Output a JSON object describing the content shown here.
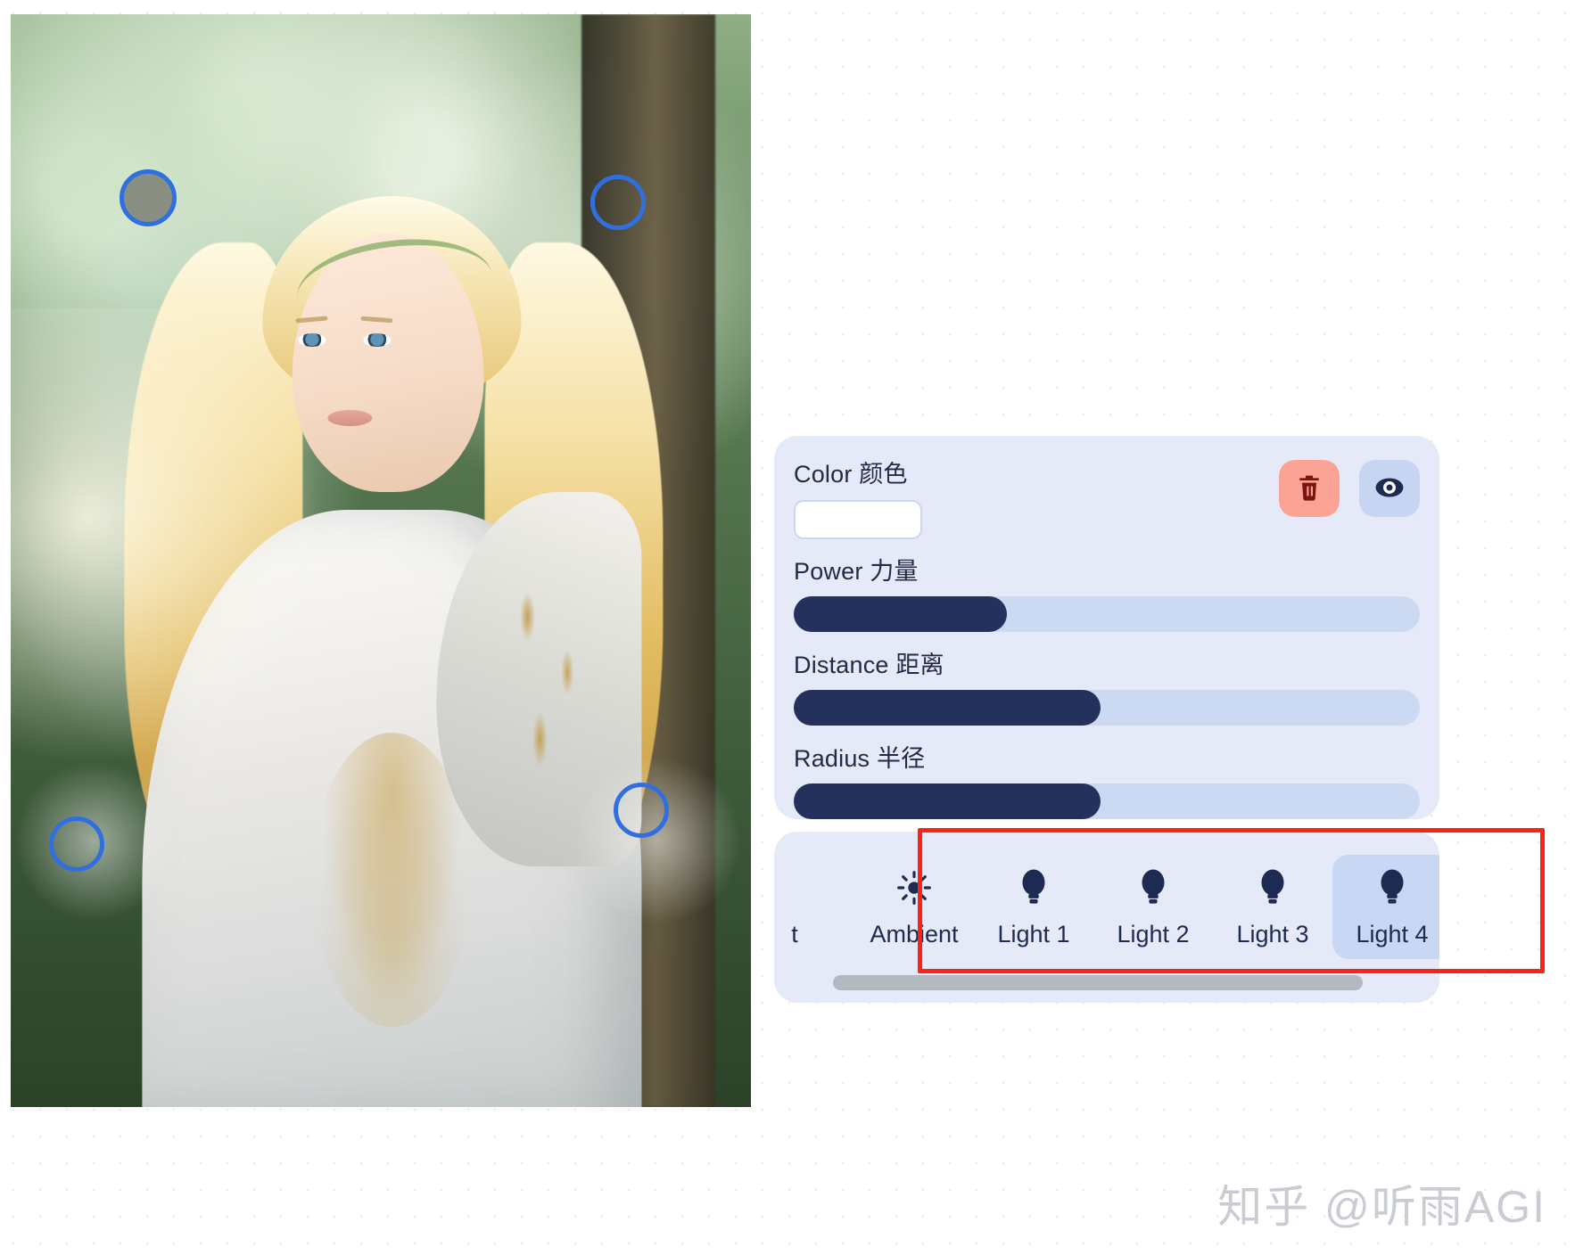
{
  "app": {
    "watermark": "知乎 @听雨AGI"
  },
  "canvas": {
    "name": "light-editor-canvas",
    "handles": [
      {
        "id": "handle-1",
        "style": "filled"
      },
      {
        "id": "handle-2",
        "style": "outline"
      },
      {
        "id": "handle-3",
        "style": "outline"
      },
      {
        "id": "handle-4",
        "style": "outline"
      }
    ]
  },
  "properties": {
    "color": {
      "label": "Color 颜色",
      "value": "#FFFFFF"
    },
    "delete_button": {
      "icon": "trash-icon",
      "color": "#FBA496"
    },
    "visibility_button": {
      "icon": "eye-icon",
      "color": "#C7D5F2"
    },
    "sliders": [
      {
        "label": "Power 力量",
        "percent": 34
      },
      {
        "label": "Distance 距离",
        "percent": 58
      },
      {
        "label": "Radius 半径",
        "percent": 58
      }
    ]
  },
  "lights": {
    "items": [
      {
        "label": "t",
        "icon": "none",
        "selected": false
      },
      {
        "label": "Ambient",
        "icon": "sun-icon",
        "selected": false
      },
      {
        "label": "Light 1",
        "icon": "bulb-icon",
        "selected": false
      },
      {
        "label": "Light 2",
        "icon": "bulb-icon",
        "selected": false
      },
      {
        "label": "Light 3",
        "icon": "bulb-icon",
        "selected": false
      },
      {
        "label": "Light 4",
        "icon": "bulb-icon",
        "selected": true
      }
    ]
  },
  "annotation": {
    "color": "#FD2216"
  }
}
